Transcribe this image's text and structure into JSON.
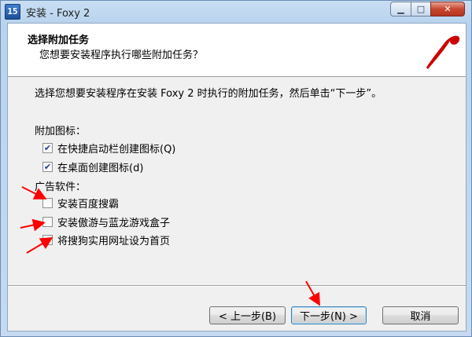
{
  "window": {
    "title": "安装 - Foxy 2",
    "icon_text": "15"
  },
  "header": {
    "title": "选择附加任务",
    "subtitle": "您想要安装程序执行哪些附加任务？"
  },
  "instruction": "选择您想要安装程序在安装 Foxy 2 时执行的附加任务，然后单击“下一步”。",
  "groups": [
    {
      "label": "附加图标：",
      "items": [
        {
          "label": "在快捷启动栏创建图标(Q)",
          "checked": true
        },
        {
          "label": "在桌面创建图标(d)",
          "checked": true
        }
      ]
    },
    {
      "label": "广告软件：",
      "items": [
        {
          "label": "安装百度搜霸",
          "checked": false
        },
        {
          "label": "安装傲游与蓝龙游戏盒子",
          "checked": false
        },
        {
          "label": "将搜狗实用网址设为首页",
          "checked": false
        }
      ]
    }
  ],
  "buttons": {
    "back": "< 上一步(B)",
    "next": "下一步(N) >",
    "cancel": "取消"
  },
  "colors": {
    "annotation_arrow": "#ff0000",
    "logo_heart": "#cc0000",
    "checkmark": "#233c8a"
  },
  "icons": {
    "minimize": "minimize-icon",
    "maximize": "maximize-icon",
    "close": "close-icon",
    "checkmark": "checkmark-icon"
  }
}
